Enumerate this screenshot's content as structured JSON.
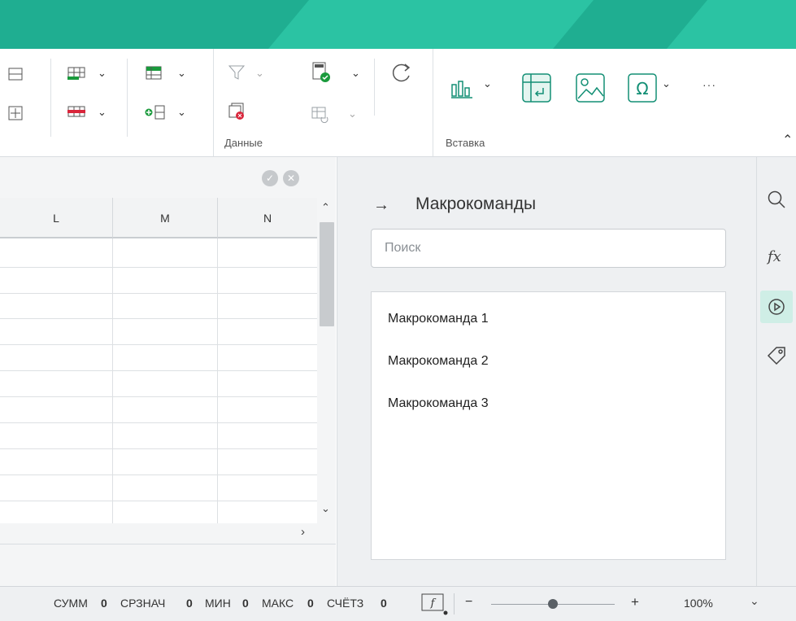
{
  "ribbon": {
    "group_data_label": "Данные",
    "group_insert_label": "Вставка",
    "more_label": "···"
  },
  "sheet": {
    "columns": [
      "L",
      "M",
      "N"
    ]
  },
  "panel": {
    "title": "Макрокоманды",
    "search_placeholder": "Поиск",
    "macros": [
      "Макрокоманда 1",
      "Макрокоманда 2",
      "Макрокоманда 3"
    ]
  },
  "statusbar": {
    "sum_label": "СУММ",
    "sum_value": "0",
    "avg_label": "СРЗНАЧ",
    "avg_value": "0",
    "min_label": "МИН",
    "min_value": "0",
    "max_label": "МАКС",
    "max_value": "0",
    "count_label": "СЧЁТЗ",
    "count_value": "0",
    "zoom_minus": "−",
    "zoom_plus": "+",
    "zoom_value": "100%",
    "zoom_level_percent": 100
  },
  "colors": {
    "accent": "#1fae91",
    "accent_light": "#2bc3a3",
    "active_side": "#cfeee6"
  },
  "icons": {
    "side": [
      "search-icon",
      "function-icon",
      "macro-play-icon",
      "tag-icon"
    ]
  }
}
